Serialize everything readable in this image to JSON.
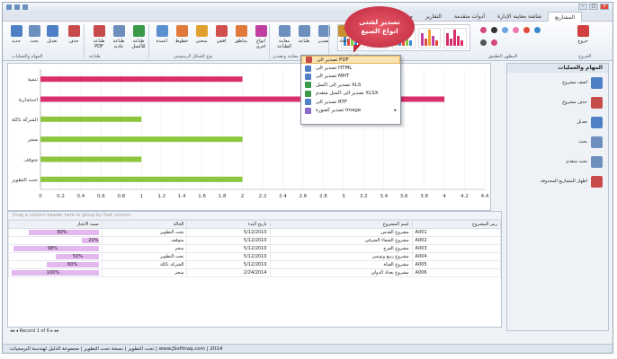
{
  "tabs": [
    "مساعدة",
    "التقارير",
    "أدوات متقدمة",
    "شاشة معاينة الإدارة",
    "المشاريع"
  ],
  "ribbon": {
    "buttons": [
      {
        "label": "جديد",
        "color": "#4f7fc4"
      },
      {
        "label": "بحث",
        "color": "#6c8fbd"
      },
      {
        "label": "تعديل",
        "color": "#4f7fc4"
      },
      {
        "label": "حذف",
        "color": "#c84b4b"
      },
      {
        "label": "طباعة PDF",
        "color": "#c84b4b"
      },
      {
        "label": "طباعة عادية",
        "color": "#6c8fbd"
      },
      {
        "label": "طباعة للأكسل",
        "color": "#3a9a4a"
      },
      {
        "label": "اعمدة",
        "color": "#5b8fd0"
      },
      {
        "label": "خطوط",
        "color": "#e07a3a"
      },
      {
        "label": "منحنى",
        "color": "#e0a030"
      },
      {
        "label": "افقي",
        "color": "#d05050"
      },
      {
        "label": "مناطق",
        "color": "#e07a3a"
      },
      {
        "label": "انواع اخرى",
        "color": "#c040a0"
      },
      {
        "label": "معاينة الطباعة",
        "color": "#6c8fbd"
      },
      {
        "label": "طباعة",
        "color": "#6c8fbd"
      },
      {
        "label": "تصدير",
        "color": "#6c8fbd"
      },
      {
        "label": "انجاد",
        "color": "#c89030"
      }
    ],
    "groups": [
      "المهام والعمليات",
      "طباعة",
      "نوع الشكل الرسومي",
      "معاينة وتصدير",
      "المظهر"
    ],
    "right_buttons": [
      {
        "label": "خروج",
        "color": "#d04040"
      }
    ],
    "right_groups": [
      "المظهر التطبيق",
      "الخروج"
    ]
  },
  "callout": "تصدير لشتى انواع الصيغ",
  "export_menu": [
    {
      "label": "تصدير الى PDF",
      "color": "#c84b4b",
      "highlight": true
    },
    {
      "label": "تصدير الى HTML",
      "color": "#4f7fc4"
    },
    {
      "label": "تصدير الى MHT",
      "color": "#4f7fc4"
    },
    {
      "label": "تصدير الى اكسل XLS",
      "color": "#3a9a4a"
    },
    {
      "label": "تصدير الى اكسل متقدم XLSX",
      "color": "#3a9a4a"
    },
    {
      "label": "تصدير الى RTF",
      "color": "#4f7fc4"
    },
    {
      "label": "تصدير كصورة Image",
      "color": "#8a6acb",
      "submenu": true
    }
  ],
  "chart_data": {
    "type": "bar",
    "orientation": "horizontal",
    "categories": [
      "تنمية",
      "استثمارية",
      "الشركة ناكلة",
      "منجز",
      "متوقف",
      "تحت التطوير"
    ],
    "values": [
      2,
      4,
      1,
      2,
      1,
      2
    ],
    "colors": [
      "#d92e6c",
      "#d92e6c",
      "#8cc63f",
      "#8cc63f",
      "#8cc63f",
      "#8cc63f"
    ],
    "xlim": [
      0,
      4.4
    ],
    "xticks": [
      "0",
      "0.2",
      "0.4",
      "0.6",
      "0.8",
      "1",
      "1.2",
      "1.4",
      "1.6",
      "1.8",
      "2",
      "2.2",
      "2.4",
      "2.6",
      "2.8",
      "3",
      "3.2",
      "3.4",
      "3.6",
      "3.8",
      "4",
      "4.2",
      "4.4"
    ],
    "grid": true
  },
  "grid": {
    "group_hint": "Drag a column header here to group by that column",
    "columns": [
      "رمز المشروع",
      "اسم المشروع",
      "تاريخ البدء",
      "الحالة",
      "نسبة الانجاز"
    ],
    "rows": [
      [
        "A001",
        "مشروع القدس",
        "5/12/2010",
        "تحت التطوير",
        "80%"
      ],
      [
        "A002",
        "مشروع الشفاء الشرقي",
        "5/12/2010",
        "متوقف",
        "20%"
      ],
      [
        "A003",
        "مشروع الفرح",
        "5/12/2010",
        "منجز",
        "98%"
      ],
      [
        "A004",
        "مشروع ربيع وتونس",
        "5/12/2010",
        "تحت التطوير",
        "50%"
      ],
      [
        "A005",
        "مشروع القناة",
        "5/12/2010",
        "الشركة ناكلة",
        "60%"
      ],
      [
        "A006",
        "مشروع بغداد الدولي",
        "2/24/2014",
        "منجز",
        "100%"
      ]
    ],
    "progress": [
      80,
      20,
      98,
      50,
      60,
      100
    ],
    "pager": "Record 1 of 6"
  },
  "side": {
    "title": "المهام والعمليات",
    "items": [
      {
        "label": "اضف مشروع",
        "color": "#4f7fc4"
      },
      {
        "label": "حذف مشروع",
        "color": "#c84b4b"
      },
      {
        "label": "تعديل",
        "color": "#4f7fc4"
      },
      {
        "label": "بحث",
        "color": "#6c8fbd"
      },
      {
        "label": "بحث متقدم",
        "color": "#6c8fbd"
      },
      {
        "label": "اظهار المشاريع المحذوفة",
        "color": "#c84b4b"
      }
    ]
  },
  "status": "تحت التطوير | نسخة تحت التطوير | مجموعة الدليل لهندسة البرمجيات | www.JSoftIraq.com | 2014"
}
